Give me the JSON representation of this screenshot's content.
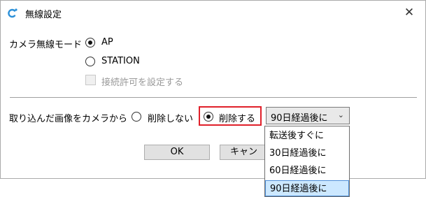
{
  "window": {
    "title": "無線設定",
    "close_glyph": "✕"
  },
  "mode": {
    "label": "カメラ無線モード",
    "options": [
      {
        "label": "AP",
        "selected": true
      },
      {
        "label": "STATION",
        "selected": false
      }
    ],
    "permit_checkbox": {
      "label": "接続許可を設定する",
      "checked": false,
      "enabled": false
    }
  },
  "import": {
    "label": "取り込んだ画像をカメラから",
    "options": [
      {
        "label": "削除しない",
        "selected": false
      },
      {
        "label": "削除する",
        "selected": true
      }
    ],
    "select_value": "90日経過後に",
    "dropdown_options": [
      "転送後すぐに",
      "30日経過後に",
      "60日経過後に",
      "90日経過後に"
    ],
    "dropdown_selected_index": 3
  },
  "buttons": {
    "ok": "OK",
    "cancel": "キャンセル"
  },
  "colors": {
    "highlight": "#e0202a",
    "selection": "#cce8ff",
    "icon_accent": "#2a8fd8"
  }
}
